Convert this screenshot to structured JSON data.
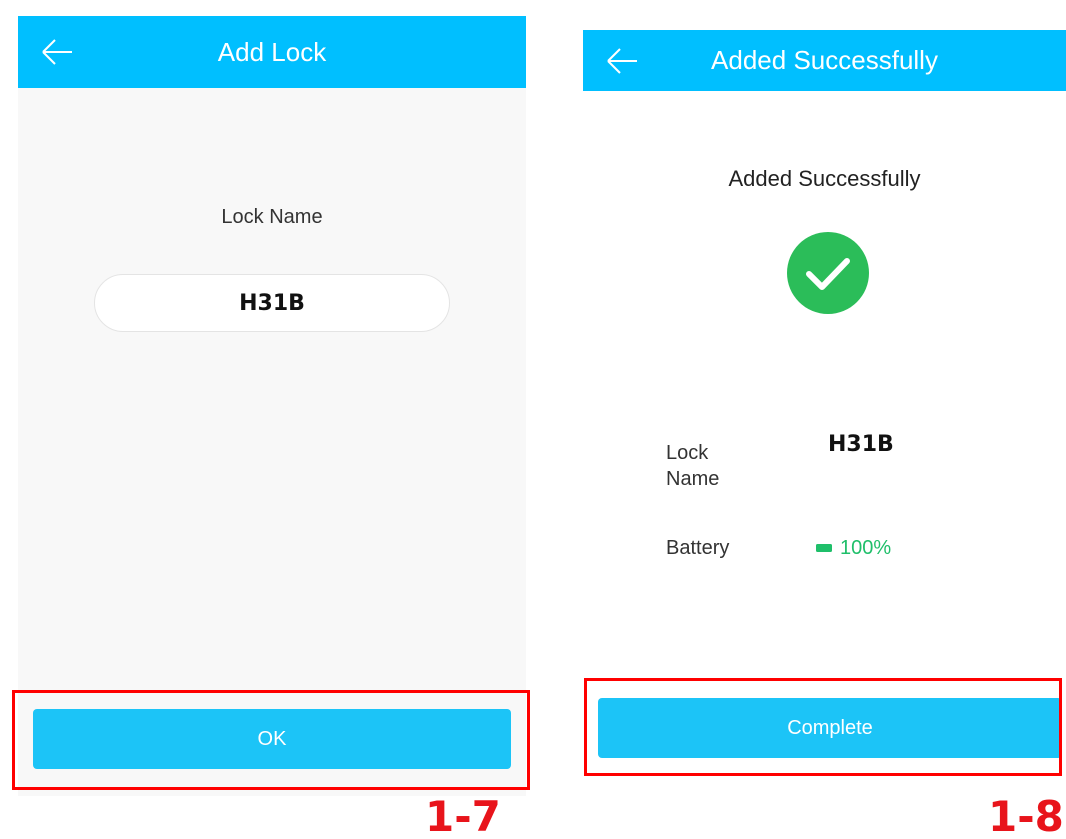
{
  "screen1": {
    "header": {
      "title": "Add Lock",
      "back_icon": "arrow-left-icon"
    },
    "lock_name_label": "Lock Name",
    "lock_name_input": {
      "value": "H31B"
    },
    "ok_button": {
      "label": "OK"
    },
    "step_label": "1-7"
  },
  "screen2": {
    "header": {
      "title": "Added Successfully",
      "back_icon": "arrow-left-icon"
    },
    "heading": "Added Successfully",
    "status_icon": "check-circle-icon",
    "lock_name": {
      "label": "Lock\nName",
      "value": "H31B"
    },
    "battery": {
      "label": "Battery",
      "value": "100%",
      "icon": "battery-icon"
    },
    "complete_button": {
      "label": "Complete"
    },
    "step_label": "1-8"
  },
  "colors": {
    "header": "#00bfff",
    "button": "#1cc4f7",
    "success_green": "#2bbd59",
    "battery_green": "#1fbf6a",
    "highlight_red": "#ff0000",
    "step_red": "#e8141b"
  }
}
